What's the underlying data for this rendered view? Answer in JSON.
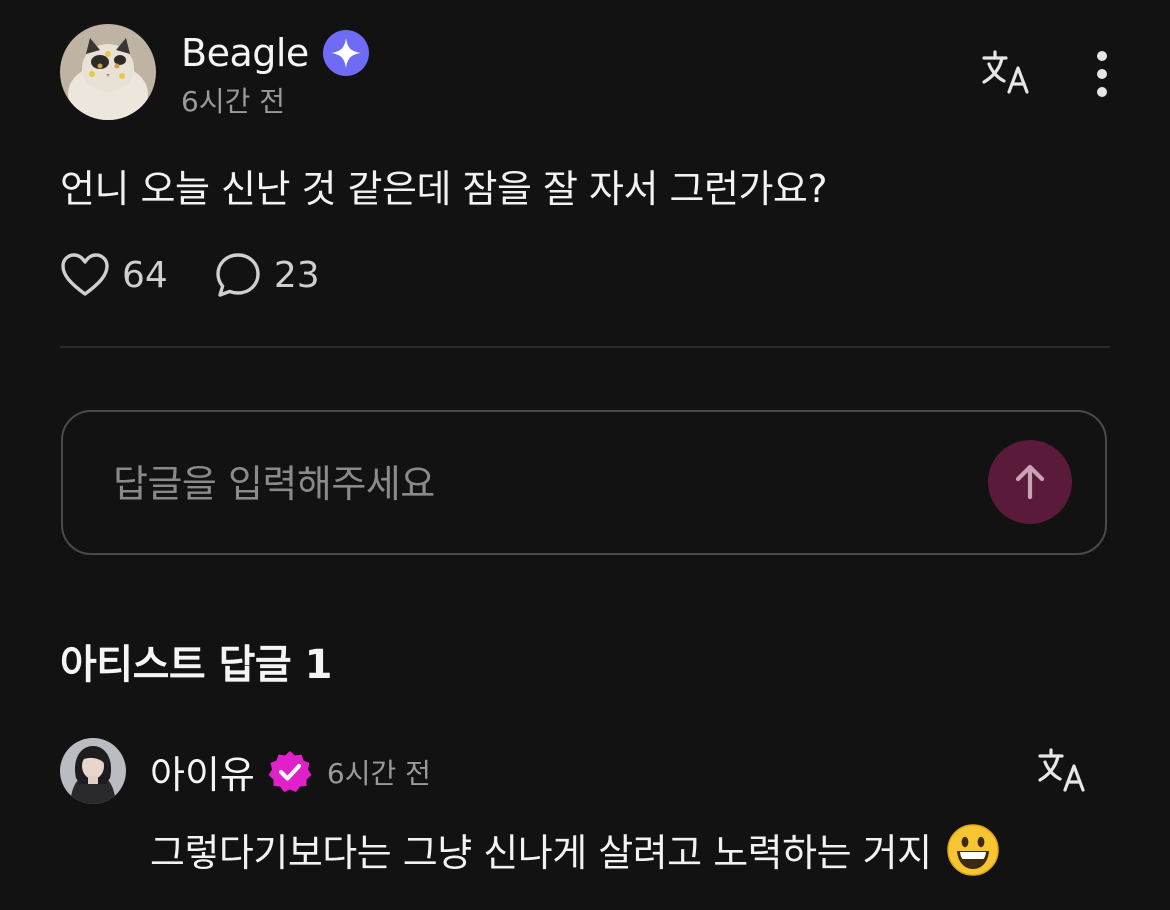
{
  "post": {
    "author": "Beagle",
    "time": "6시간 전",
    "text": "언니 오늘 신난 것 같은데 잠을 잘 자서 그런가요?",
    "likes": "64",
    "comments": "23"
  },
  "reply_input": {
    "placeholder": "답글을 입력해주세요"
  },
  "artist_replies": {
    "title": "아티스트 답글 1",
    "items": [
      {
        "author": "아이유",
        "time": "6시간 전",
        "text": "그렇다기보다는 그냥 신나게 살려고 노력하는 거지",
        "emoji": "grinning-face"
      }
    ]
  },
  "colors": {
    "background": "#121212",
    "star_badge": "#6e6cf5",
    "verified_badge": "#e020c8",
    "send_button": "#5a1a3a"
  }
}
